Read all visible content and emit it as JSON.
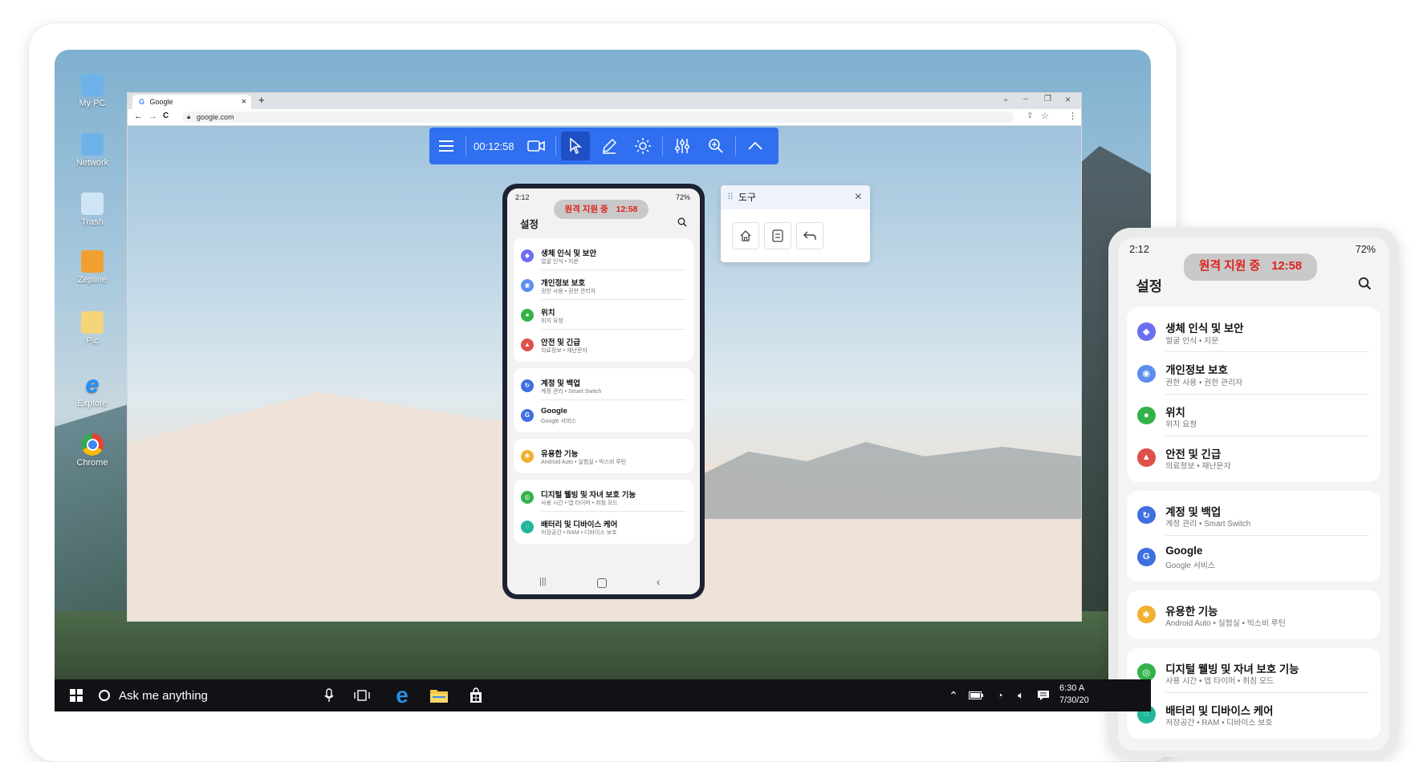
{
  "desktop_icons": [
    {
      "label": "My PC",
      "icon": "monitor-icon",
      "color": "#6fb2ea"
    },
    {
      "label": "Network",
      "icon": "network-icon",
      "color": "#6fb2ea"
    },
    {
      "label": "Trash",
      "icon": "trash-icon",
      "color": "#cfe4f5"
    },
    {
      "label": "Zepline",
      "icon": "zeplin-icon",
      "color": "#f0a030"
    },
    {
      "label": "Pic",
      "icon": "folder-icon",
      "color": "#f4d57a"
    },
    {
      "label": "Explore",
      "icon": "ie-icon",
      "color": "#1e90ff"
    },
    {
      "label": "Chrome",
      "icon": "chrome-icon",
      "color": "#e34133"
    }
  ],
  "browser": {
    "tab_title": "Google",
    "tab_close": "×",
    "new_tab": "+",
    "url": "google.com",
    "nav_back": "←",
    "nav_forward": "→",
    "nav_reload": "C",
    "win_chevron": "⌄",
    "win_minimize": "–",
    "win_restore": "❐",
    "win_close": "×"
  },
  "toolbar": {
    "timer": "00:12:58"
  },
  "tools_panel": {
    "title": "도구",
    "close": "×"
  },
  "phone": {
    "status_time": "2:12",
    "battery": "72%",
    "remote_label": "원격 지원 중",
    "remote_time": "12:58",
    "title": "설정",
    "groups": [
      [
        {
          "title": "생체 인식 및 보안",
          "subtitle": "얼굴 인식 • 지문",
          "color": "#6c6ff0",
          "glyph": "◆"
        },
        {
          "title": "개인정보 보호",
          "subtitle": "권한 사용 • 권한 관리자",
          "color": "#5b8ef0",
          "glyph": "◉"
        },
        {
          "title": "위치",
          "subtitle": "위치 요청",
          "color": "#33b24a",
          "glyph": "●"
        },
        {
          "title": "안전 및 긴급",
          "subtitle": "의료정보 • 재난문자",
          "color": "#e0504a",
          "glyph": "▲"
        }
      ],
      [
        {
          "title": "계정 및 백업",
          "subtitle": "계정 관리 • Smart Switch",
          "color": "#3f6fe0",
          "glyph": "↻"
        },
        {
          "title": "Google",
          "subtitle": "Google 서비스",
          "color": "#3f6fe0",
          "glyph": "G"
        }
      ],
      [
        {
          "title": "유용한 기능",
          "subtitle": "Android Auto • 실험실 • 빅스비 루틴",
          "color": "#f0b030",
          "glyph": "✱"
        }
      ],
      [
        {
          "title": "디지털 웰빙 및 자녀 보호 기능",
          "subtitle": "사용 시간 • 앱 타이머 • 취침 모드",
          "color": "#33b24a",
          "glyph": "◎"
        },
        {
          "title": "배터리 및 디바이스 케어",
          "subtitle": "저장공간 • RAM • 디바이스 보호",
          "color": "#22b79a",
          "glyph": "◌"
        }
      ]
    ]
  },
  "taskbar": {
    "search_placeholder": "Ask me anything",
    "time": "6:30 A",
    "date": "7/30/20"
  }
}
